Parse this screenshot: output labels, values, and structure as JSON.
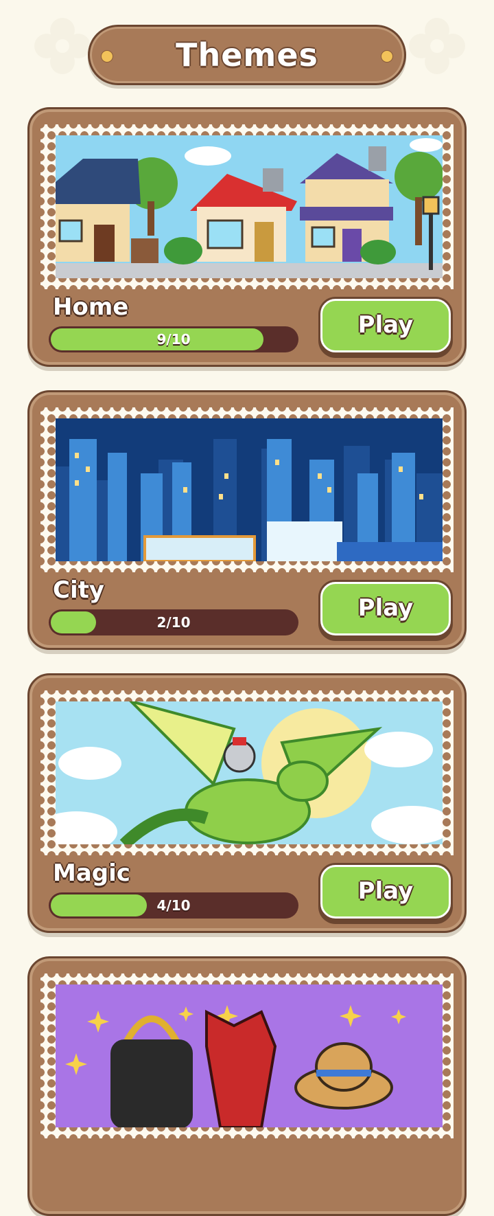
{
  "header": {
    "title": "Themes"
  },
  "colors": {
    "background": "#fbf8ec",
    "card": "#a87a58",
    "card_border": "#6b4630",
    "progress_track": "#5a2e2a",
    "progress_fill": "#95d652",
    "play_button": "#95d652"
  },
  "themes": [
    {
      "name": "Home",
      "progress_text": "9/10",
      "progress": 0.9,
      "play_label": "Play",
      "image_icon": "houses-illustration"
    },
    {
      "name": "City",
      "progress_text": "2/10",
      "progress": 0.2,
      "play_label": "Play",
      "image_icon": "city-skyline-illustration"
    },
    {
      "name": "Magic",
      "progress_text": "4/10",
      "progress": 0.4,
      "play_label": "Play",
      "image_icon": "knight-dragon-illustration"
    },
    {
      "name": "",
      "progress_text": "",
      "play_label": "",
      "image_icon": "fashion-items-illustration"
    }
  ]
}
